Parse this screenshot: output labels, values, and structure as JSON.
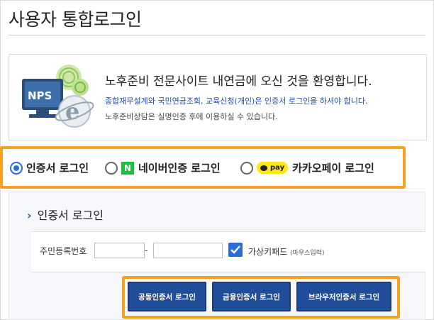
{
  "page": {
    "title": "사용자 통합로그인"
  },
  "welcome": {
    "logo_text": "NPS",
    "heading": "노후준비 전문사이트 내연금에 오신 것을 환영합니다.",
    "line1": "종합재무설계와 국민연금조회, 교육신청(개인)은 인증서 로그인을 하셔야 합니다.",
    "line2": "노후준비상담은 실명인증 후에 이용하실 수 있습니다."
  },
  "login_options": [
    {
      "label": "인증서 로그인",
      "selected": true
    },
    {
      "label": "네이버인증 로그인",
      "badge": "N",
      "selected": false
    },
    {
      "label": "카카오페이 로그인",
      "badge": "pay",
      "selected": false
    }
  ],
  "section": {
    "title": "인증서 로그인"
  },
  "form": {
    "rrn_label": "주민등록번호",
    "rrn_front_value": "",
    "rrn_separator": "-",
    "rrn_back_value": "",
    "virtual_keypad_label": "가상키패드",
    "virtual_keypad_hint": "(마우스입력)",
    "virtual_keypad_checked": true
  },
  "buttons": {
    "joint_cert": "공동인증서 로그인",
    "financial_cert": "금융인증서 로그인",
    "browser_cert": "브라우저인증서 로그인"
  },
  "colors": {
    "highlight": "#f7a021",
    "primary_button": "#1f4d9a",
    "radio_accent": "#2a6dd8",
    "naver_green": "#19c13b",
    "kakao_yellow": "#ffe812"
  }
}
